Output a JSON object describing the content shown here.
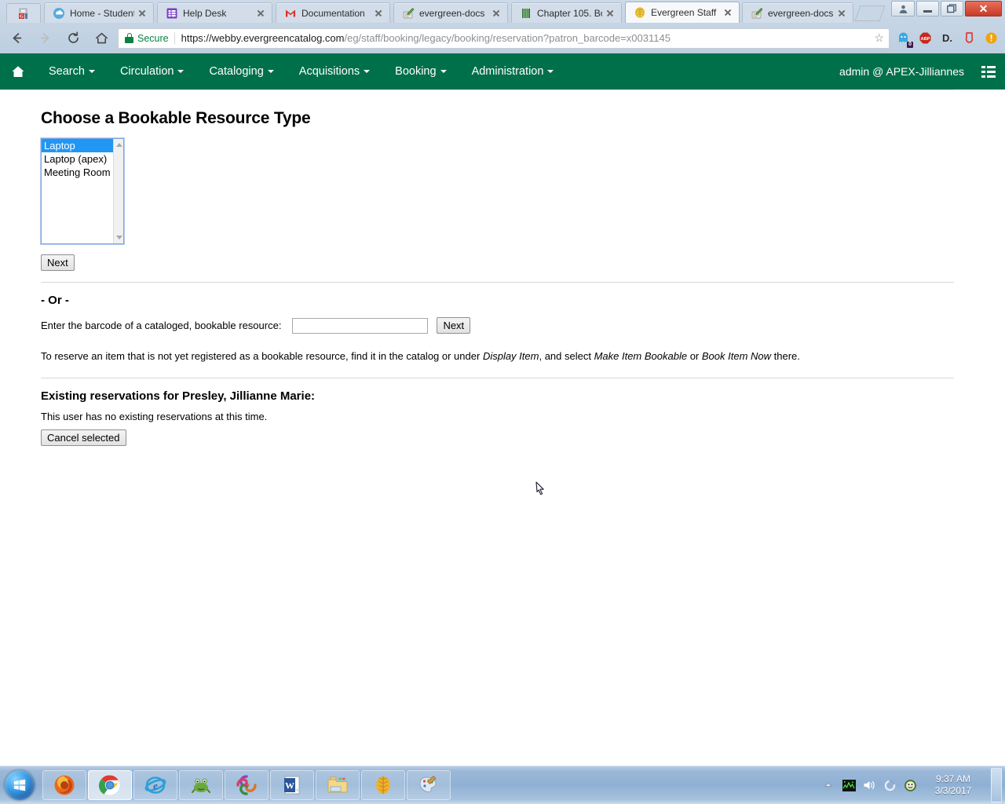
{
  "browser": {
    "tabs": [
      {
        "title": "Home - Student",
        "favicon": "cloud-icon",
        "active": false
      },
      {
        "title": "Help Desk",
        "favicon": "grid-purple-icon",
        "active": false
      },
      {
        "title": "Documentation",
        "favicon": "gmail-m-icon",
        "active": false
      },
      {
        "title": "evergreen-docs",
        "favicon": "pencil-book-icon",
        "active": false
      },
      {
        "title": "Chapter 105. Bo",
        "favicon": "green-book-icon",
        "active": false
      },
      {
        "title": "Evergreen Staff",
        "favicon": "evergreen-leaf-icon",
        "active": true
      },
      {
        "title": "evergreen-docs",
        "favicon": "pencil-book-icon",
        "active": false
      }
    ],
    "pinned_tab_icon": "red-g-document-icon",
    "window_controls": [
      {
        "name": "user-profile-button",
        "glyph": "♟"
      },
      {
        "name": "minimize-button",
        "glyph": "—"
      },
      {
        "name": "restore-button",
        "glyph": "❐"
      },
      {
        "name": "close-button",
        "glyph": "✕"
      }
    ],
    "toolbar": {
      "back_icon": "back-arrow-icon",
      "forward_icon": "forward-arrow-icon",
      "reload_icon": "reload-icon",
      "home_icon": "home-icon",
      "security_label": "Secure",
      "url_scheme_domain": "https://webby.evergreencatalog.com",
      "url_path": "/eg/staff/booking/legacy/booking/reservation?patron_barcode=x0031145",
      "url_full": "https://webby.evergreencatalog.com/eg/staff/booking/legacy/booking/reservation?patron_barcode=x0031145",
      "bookmark_icon": "star-icon",
      "extensions": [
        {
          "name": "ghostery-icon",
          "label": "",
          "badge": "0",
          "color": "#3aa9e0"
        },
        {
          "name": "adblock-plus-icon",
          "label": "ABP",
          "color": "#c9271e"
        },
        {
          "name": "disconnect-icon",
          "label": "D.",
          "color": "#2b2b2b"
        },
        {
          "name": "opera-blocker-icon",
          "label": "",
          "color": "#e03a3a"
        },
        {
          "name": "alert-circle-icon",
          "label": "!",
          "color": "#f0a30a"
        }
      ]
    }
  },
  "app": {
    "navbar": {
      "home_icon": "home-icon",
      "menus": [
        {
          "label": "Search",
          "has_caret": true
        },
        {
          "label": "Circulation",
          "has_caret": true
        },
        {
          "label": "Cataloging",
          "has_caret": true
        },
        {
          "label": "Acquisitions",
          "has_caret": true
        },
        {
          "label": "Booking",
          "has_caret": true
        },
        {
          "label": "Administration",
          "has_caret": true
        }
      ],
      "user": "admin @ APEX-Jilliannes",
      "grid_icon": "grid-menu-icon",
      "background_color": "#00704a"
    },
    "main": {
      "page_title": "Choose a Bookable Resource Type",
      "resource_types": [
        {
          "label": "Laptop",
          "selected": true
        },
        {
          "label": "Laptop (apex)",
          "selected": false
        },
        {
          "label": "Meeting Room",
          "selected": false
        }
      ],
      "next_button_label": "Next",
      "or_label": "- Or -",
      "barcode_label": "Enter the barcode of a cataloged, bookable resource:",
      "barcode_value": "",
      "barcode_next_button_label": "Next",
      "note": {
        "part1": "To reserve an item that is not yet registered as a bookable resource, find it in the catalog or under ",
        "em1": "Display Item",
        "part2": ", and select ",
        "em2": "Make Item Bookable",
        "part3": " or ",
        "em3": "Book Item Now",
        "part4": " there."
      },
      "reservations_title": "Existing reservations for Presley, Jillianne Marie:",
      "reservations_empty": "This user has no existing reservations at this time.",
      "cancel_selected_label": "Cancel selected"
    }
  },
  "taskbar": {
    "start_icon": "windows-start-orb-icon",
    "apps": [
      {
        "name": "firefox-icon",
        "active": false
      },
      {
        "name": "google-chrome-icon",
        "active": true
      },
      {
        "name": "internet-explorer-icon",
        "active": false
      },
      {
        "name": "frog-icon",
        "active": false
      },
      {
        "name": "swirl-icon",
        "active": false
      },
      {
        "name": "microsoft-word-icon",
        "active": false
      },
      {
        "name": "file-explorer-icon",
        "active": false
      },
      {
        "name": "palm-leaf-icon",
        "active": false
      },
      {
        "name": "paint-palette-icon",
        "active": false
      }
    ],
    "tray": [
      {
        "name": "show-hidden-icons-chevron-icon"
      },
      {
        "name": "network-monitor-icon"
      },
      {
        "name": "volume-speaker-icon"
      },
      {
        "name": "loading-spinner-icon"
      },
      {
        "name": "green-smiley-icon"
      }
    ],
    "clock_time": "9:37 AM",
    "clock_date": "3/3/2017"
  }
}
